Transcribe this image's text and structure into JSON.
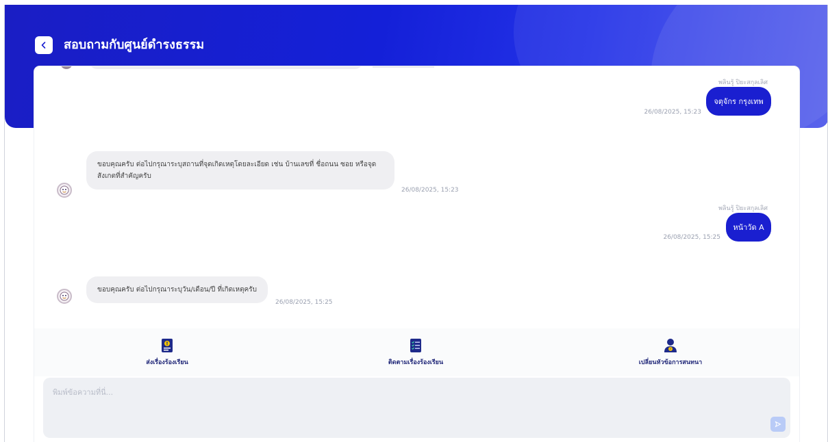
{
  "header": {
    "title": "สอบถามกับศูนย์ดำรงธรรม",
    "back_icon": "chevron-left-icon"
  },
  "messages": [
    {
      "type": "outgoing",
      "sender": "พลินรู้ ปิยะสกุลเลิศ",
      "text": "จตุจักร กรุงเทพ",
      "time": "26/08/2025, 15:23"
    },
    {
      "type": "incoming",
      "text": "ขอบคุณครับ ต่อไปกรุณาระบุสถานที่จุดเกิดเหตุโดยละเอียด เช่น บ้านเลขที่ ชื่อถนน ซอย หรือจุดสังเกตที่สำคัญครับ",
      "time": "26/08/2025, 15:23"
    },
    {
      "type": "outgoing",
      "sender": "พลินรู้ ปิยะสกุลเลิศ",
      "text": "หน้าวัด A",
      "time": "26/08/2025, 15:25"
    },
    {
      "type": "incoming",
      "text": "ขอบคุณครับ ต่อไปกรุณาระบุวัน/เดือน/ปี ที่เกิดเหตุครับ",
      "time": "26/08/2025, 15:25"
    }
  ],
  "actions": [
    {
      "label": "ส่งเรื่องร้องเรียน",
      "icon": "complaint-document-icon"
    },
    {
      "label": "ติดตามเรื่องร้องเรียน",
      "icon": "checklist-document-icon"
    },
    {
      "label": "เปลี่ยนหัวข้อการสนทนา",
      "icon": "person-question-icon"
    }
  ],
  "composer": {
    "placeholder": "พิมพ์ข้อความที่นี่...",
    "send_icon": "send-icon"
  },
  "colors": {
    "primary": "#1a1fd0",
    "bubble_in": "#efeff2",
    "action_text": "#232a7a"
  }
}
